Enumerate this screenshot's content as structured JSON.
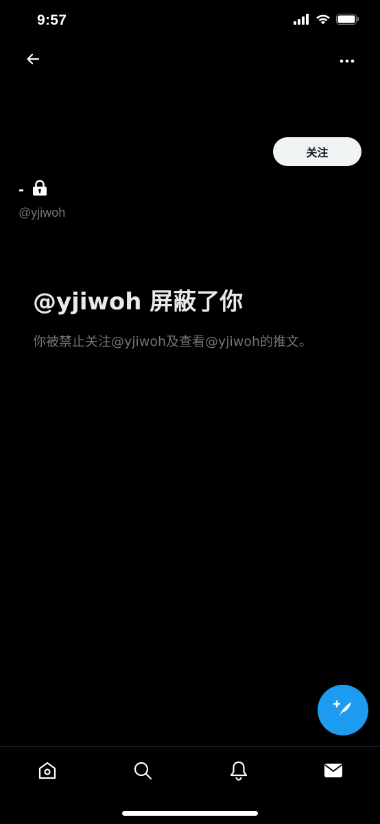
{
  "status_bar": {
    "time": "9:57",
    "icons": [
      "cellular-signal-icon",
      "wifi-icon",
      "battery-icon"
    ]
  },
  "header": {
    "back_icon": "arrow-left-icon",
    "more_icon": "more-horizontal-icon"
  },
  "profile": {
    "display_name": "-",
    "lock_icon": "lock-icon",
    "handle": "@yjiwoh",
    "follow_label": "关注"
  },
  "blocked_notice": {
    "title": "@yjiwoh 屏蔽了你",
    "description": "你被禁止关注@yjiwoh及查看@yjiwoh的推文。"
  },
  "compose": {
    "icon": "compose-tweet-icon"
  },
  "tab_bar": {
    "tabs": [
      {
        "name": "home",
        "icon": "home-icon"
      },
      {
        "name": "search",
        "icon": "search-icon"
      },
      {
        "name": "notifications",
        "icon": "bell-icon"
      },
      {
        "name": "messages",
        "icon": "mail-icon"
      }
    ]
  },
  "colors": {
    "background": "#000000",
    "accent": "#1d9bf0",
    "text_primary": "#e7e9ea",
    "text_secondary": "#71767b"
  }
}
